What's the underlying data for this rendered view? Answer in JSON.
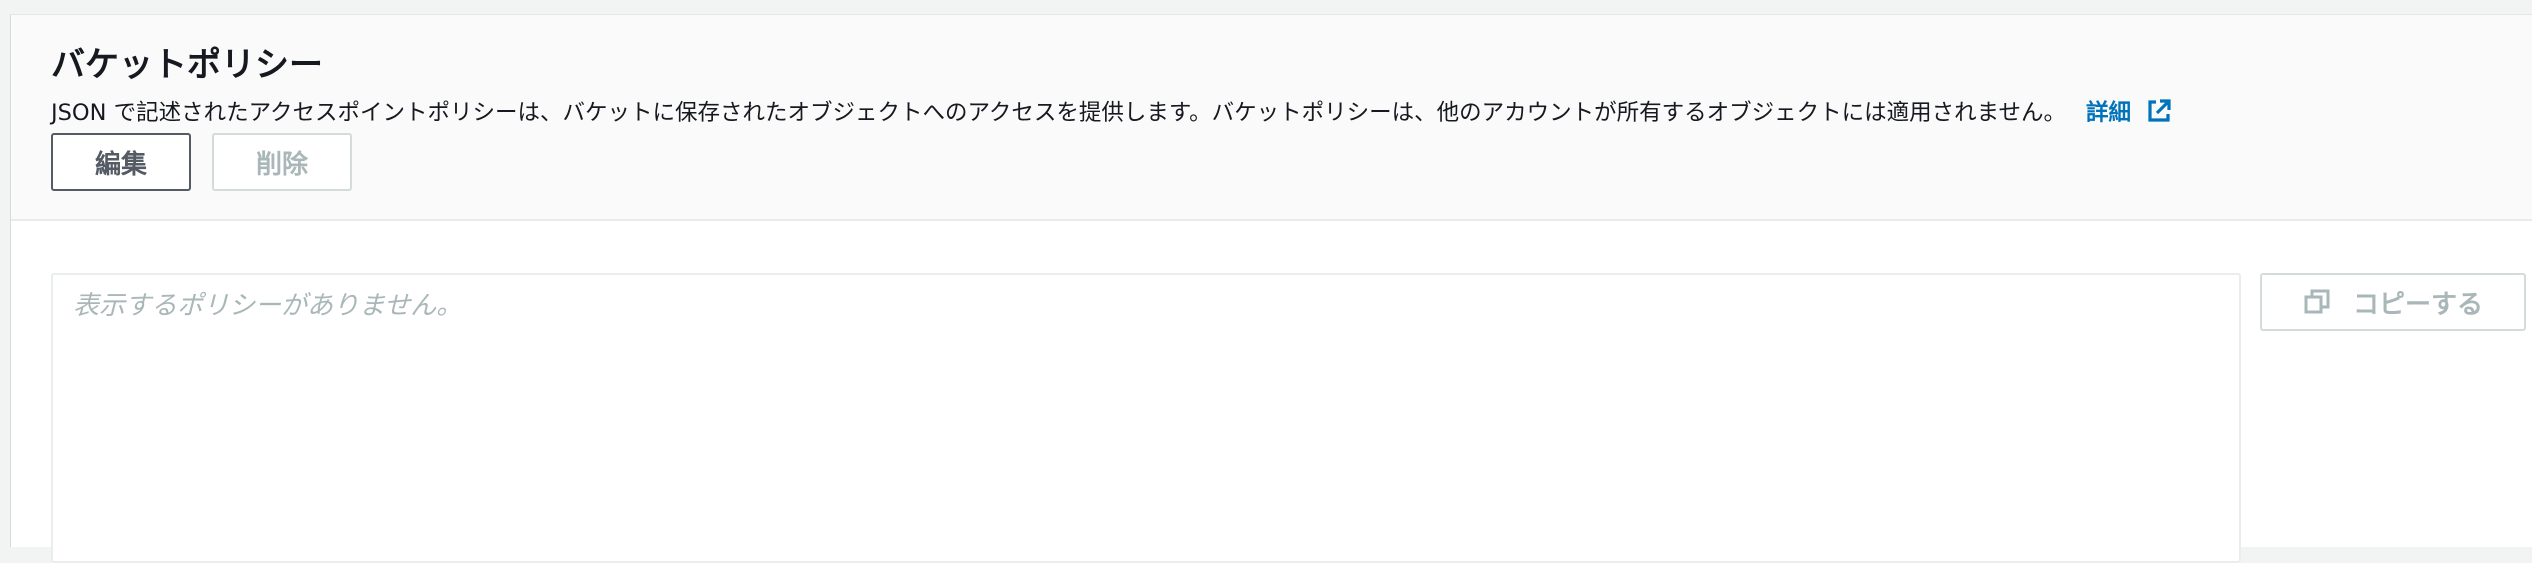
{
  "section": {
    "title": "バケットポリシー",
    "description": "JSON で記述されたアクセスポイントポリシーは、バケットに保存されたオブジェクトへのアクセスを提供します。バケットポリシーは、他のアカウントが所有するオブジェクトには適用されません。",
    "details_link": "詳細",
    "details_icon": "external-link-icon"
  },
  "actions": {
    "edit_label": "編集",
    "delete_label": "削除"
  },
  "policy": {
    "placeholder": "表示するポリシーがありません。",
    "copy_label": "コピーする",
    "copy_icon": "copy-icon"
  },
  "colors": {
    "link": "#0073bb",
    "disabled": "#aab7b8",
    "title": "#16191f"
  }
}
